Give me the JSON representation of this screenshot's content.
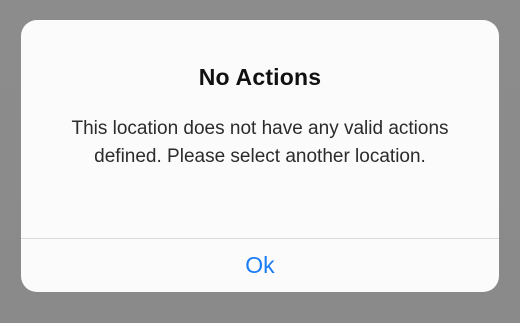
{
  "alert": {
    "title": "No Actions",
    "message": "This location does not have any valid actions defined. Please select another location.",
    "ok_label": "Ok"
  },
  "colors": {
    "backdrop": "#8e8e8e",
    "dialog_background": "#fbfbfb",
    "button_text": "#1a7cf5"
  }
}
